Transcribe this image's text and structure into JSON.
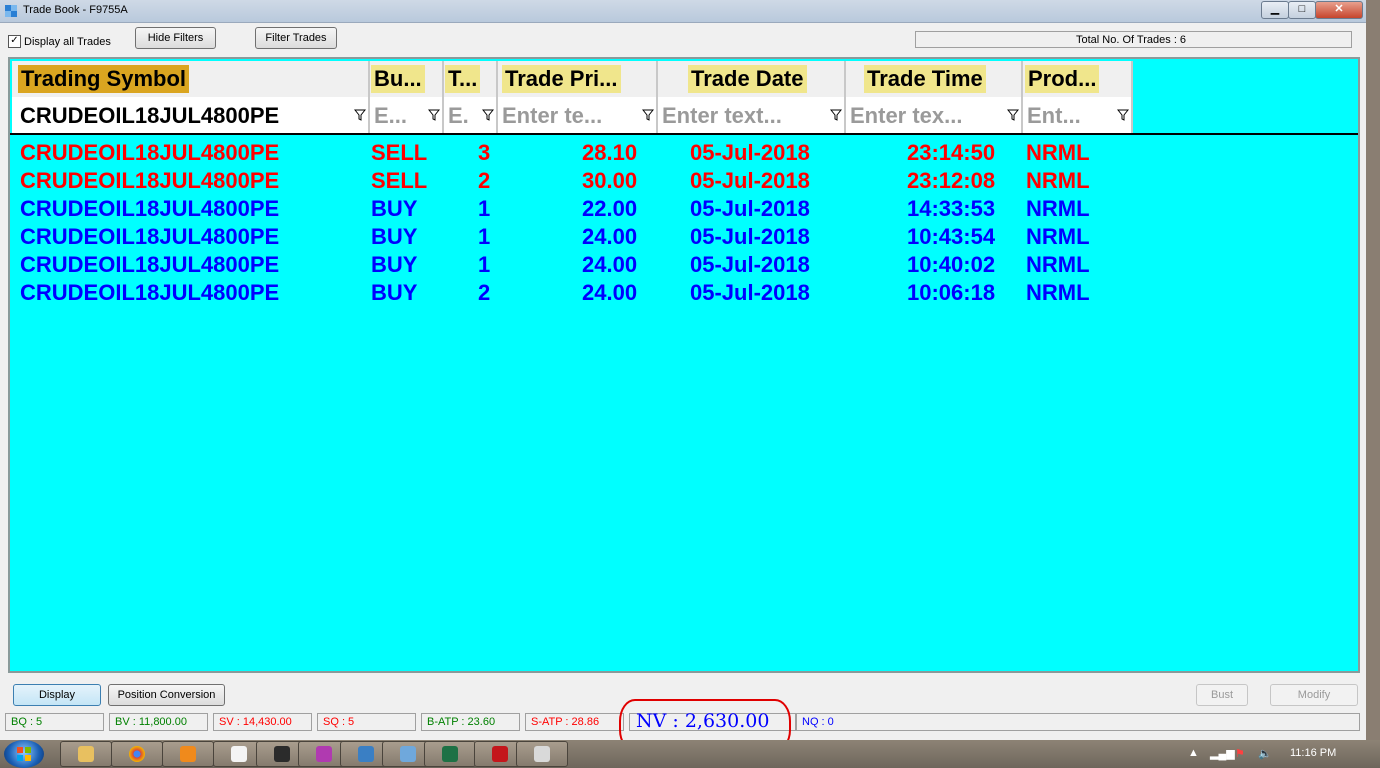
{
  "window": {
    "title": "Trade Book - F9755A",
    "min": "▁",
    "max": "□",
    "close": "✕"
  },
  "toolbar": {
    "display_all_label": "Display all Trades",
    "display_all_checked": "✓",
    "hide_filters": "Hide Filters",
    "filter_trades": "Filter Trades",
    "total_trades": "Total No. Of Trades : 6"
  },
  "grid": {
    "columns": [
      "Trading Symbol",
      "Bu...",
      "T...",
      "Trade Pri...",
      "Trade Date",
      "Trade Time",
      "Prod..."
    ],
    "filters": [
      "CRUDEOIL18JUL4800PE",
      "E...",
      "E.",
      "Enter te...",
      "Enter text...",
      "Enter tex...",
      "Ent..."
    ],
    "rows": [
      [
        "CRUDEOIL18JUL4800PE",
        "SELL",
        "3",
        "28.10",
        "05-Jul-2018",
        "23:14:50",
        "NRML"
      ],
      [
        "CRUDEOIL18JUL4800PE",
        "SELL",
        "2",
        "30.00",
        "05-Jul-2018",
        "23:12:08",
        "NRML"
      ],
      [
        "CRUDEOIL18JUL4800PE",
        "BUY",
        "1",
        "22.00",
        "05-Jul-2018",
        "14:33:53",
        "NRML"
      ],
      [
        "CRUDEOIL18JUL4800PE",
        "BUY",
        "1",
        "24.00",
        "05-Jul-2018",
        "10:43:54",
        "NRML"
      ],
      [
        "CRUDEOIL18JUL4800PE",
        "BUY",
        "1",
        "24.00",
        "05-Jul-2018",
        "10:40:02",
        "NRML"
      ],
      [
        "CRUDEOIL18JUL4800PE",
        "BUY",
        "2",
        "24.00",
        "05-Jul-2018",
        "10:06:18",
        "NRML"
      ]
    ],
    "colors": {
      "background": "#00ffff",
      "sell": "#ff0000",
      "buy": "#0000ff"
    }
  },
  "actions": {
    "display": "Display",
    "position_conversion": "Position Conversion",
    "bust": "Bust",
    "modify": "Modify"
  },
  "status": {
    "bq": "BQ : 5",
    "bv": "BV : 11,800.00",
    "sv": "SV : 14,430.00",
    "sq": "SQ : 5",
    "batp": "B-ATP : 23.60",
    "satp": "S-ATP : 28.86",
    "nv": "NV : 2,630.00",
    "nq": "NQ : 0"
  },
  "taskbar": {
    "clock": "11:16 PM"
  }
}
